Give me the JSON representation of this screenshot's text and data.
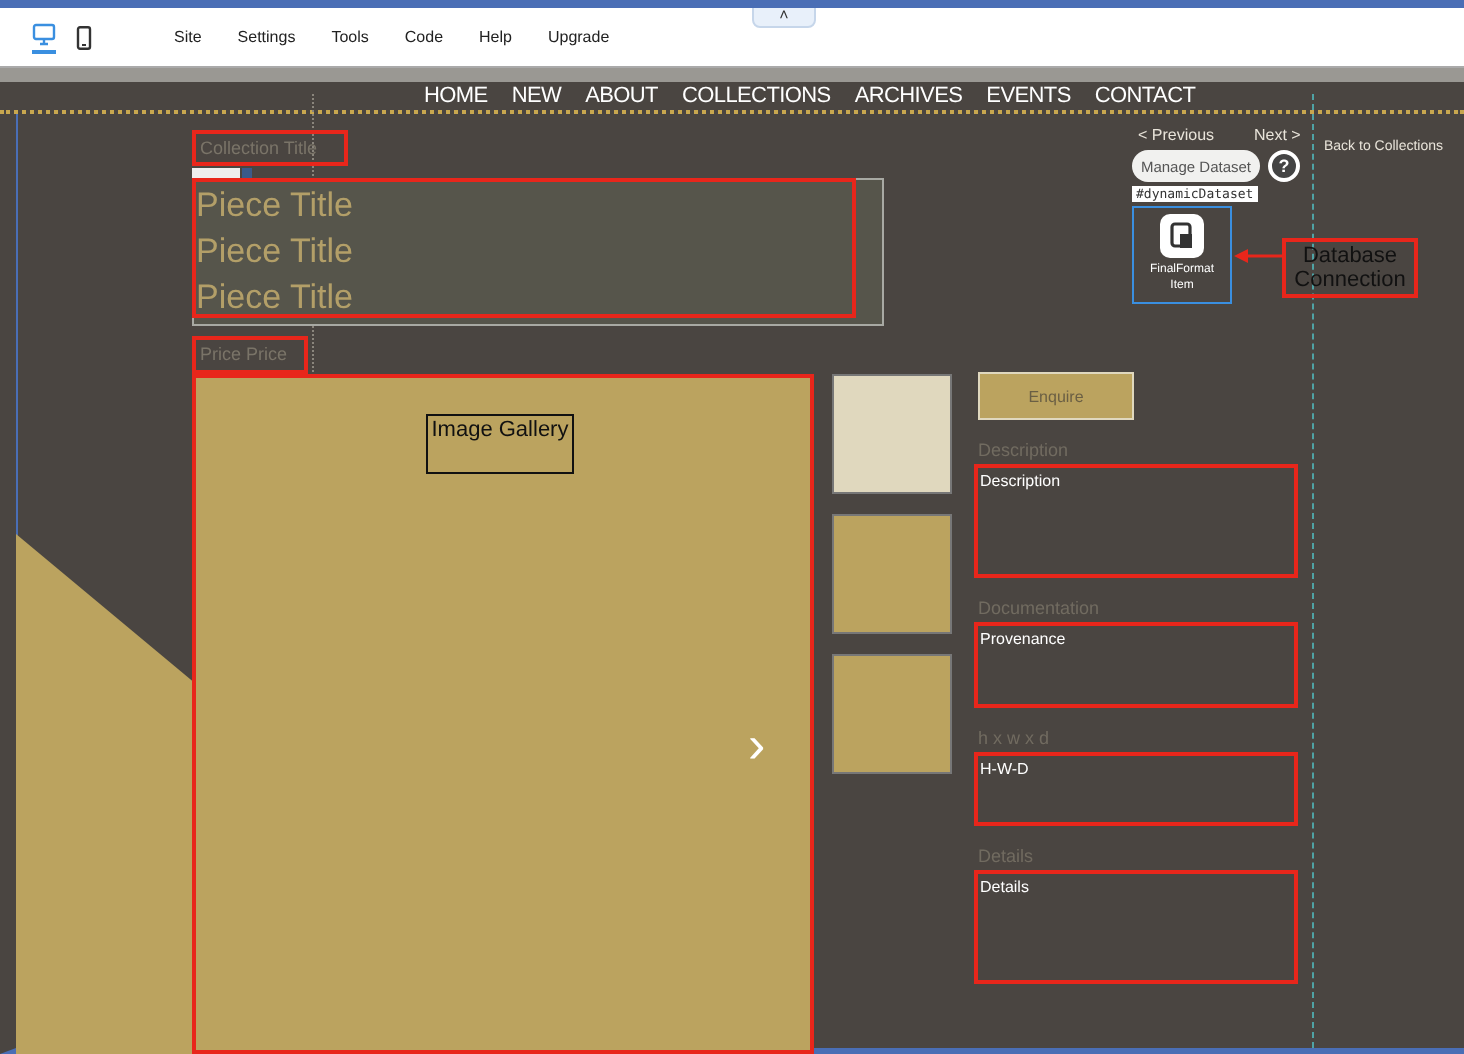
{
  "toolbar": {
    "devices": [
      {
        "kind": "desktop",
        "selected": true
      },
      {
        "kind": "mobile",
        "selected": false
      }
    ],
    "menu": [
      "Site",
      "Settings",
      "Tools",
      "Code",
      "Help",
      "Upgrade"
    ],
    "collapse": "˄"
  },
  "nav": [
    "HOME",
    "NEW",
    "ABOUT",
    "COLLECTIONS",
    "ARCHIVES",
    "EVENTS",
    "CONTACT"
  ],
  "page": {
    "collection_title": "Collection Title",
    "piece_titles": [
      "Piece Title",
      "Piece Title",
      "Piece Title"
    ],
    "price": "Price  Price",
    "gallery": {
      "label": "Image Gallery",
      "next": "›"
    },
    "thumbnails": [
      {
        "color": "#e0d8be"
      },
      {
        "color": "#bba35f"
      },
      {
        "color": "#bba35f"
      }
    ],
    "enquire": "Enquire",
    "fields": [
      {
        "label": "Description",
        "value": "Description"
      },
      {
        "label": "Documentation",
        "value": "Provenance"
      },
      {
        "label": "h x w x d",
        "value": "H-W-D"
      },
      {
        "label": "Details",
        "value": "Details"
      }
    ],
    "pager": {
      "previous": "< Previous",
      "next": "Next >",
      "back": "Back to Collections"
    },
    "dataset": {
      "manage": "Manage Dataset",
      "help": "?",
      "id": "#dynamicDataset",
      "name": "FinalFormat Item"
    },
    "annotation": "Database Connection"
  }
}
